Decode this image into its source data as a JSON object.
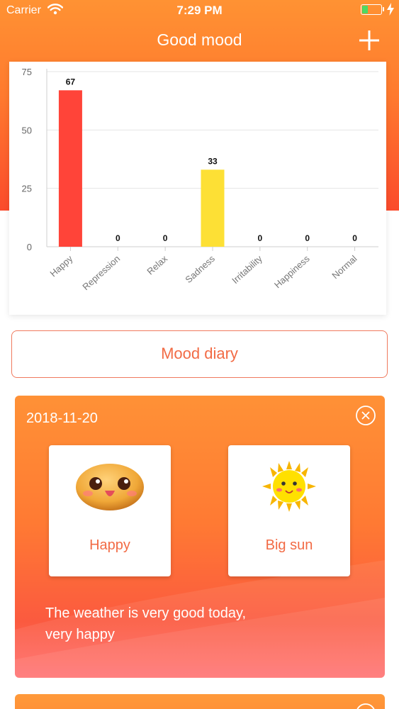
{
  "status_bar": {
    "carrier": "Carrier",
    "time": "7:29 PM",
    "battery_level": 0.3,
    "icons": [
      "wifi-icon",
      "battery-icon",
      "charging-bolt-icon"
    ]
  },
  "nav": {
    "title": "Good mood",
    "add_icon": "plus-icon"
  },
  "colors": {
    "header_top": "#ff9233",
    "header_bottom": "#fb4b2c",
    "accent_text": "#f26b45",
    "bar_happy": "#ff4439",
    "bar_sadness": "#fde035"
  },
  "chart_data": {
    "type": "bar",
    "categories": [
      "Happy",
      "Repression",
      "Relax",
      "Sadness",
      "Irritability",
      "Happiness",
      "Normal"
    ],
    "values": [
      67,
      0,
      0,
      33,
      0,
      0,
      0
    ],
    "bar_colors": [
      "#ff4439",
      "#ff4439",
      "#ff4439",
      "#fde035",
      "#ff4439",
      "#ff4439",
      "#ff4439"
    ],
    "yticks": [
      0,
      25,
      50,
      75
    ],
    "ylim": [
      0,
      75
    ],
    "grid": true,
    "title": "",
    "xlabel": "",
    "ylabel": ""
  },
  "diary_button": {
    "label": "Mood diary"
  },
  "entries": [
    {
      "date": "2018-11-20",
      "mood": {
        "label": "Happy",
        "icon": "happy-face-icon"
      },
      "weather": {
        "label": "Big sun",
        "icon": "sun-icon"
      },
      "note_line1": "The weather is very good today,",
      "note_line2": "very happy",
      "close_icon": "close-circle-icon"
    }
  ]
}
